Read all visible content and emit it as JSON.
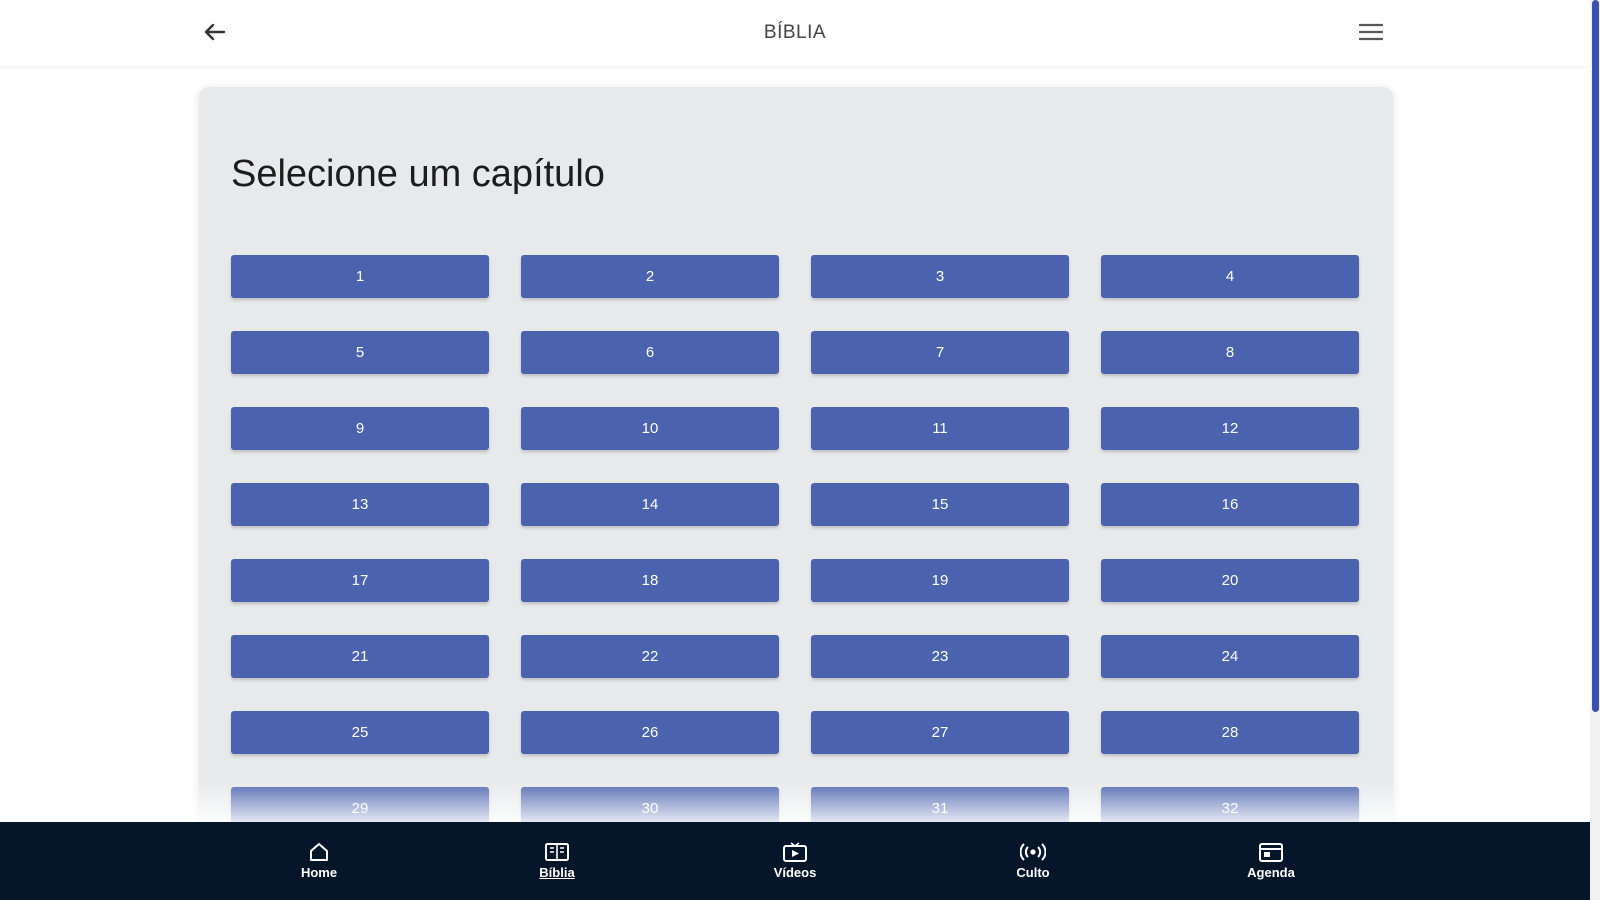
{
  "header": {
    "title": "BÍBLIA",
    "back_icon": "arrow-left-icon",
    "menu_icon": "hamburger-menu-icon"
  },
  "content": {
    "heading": "Selecione um capítulo",
    "chapters": [
      "1",
      "2",
      "3",
      "4",
      "5",
      "6",
      "7",
      "8",
      "9",
      "10",
      "11",
      "12",
      "13",
      "14",
      "15",
      "16",
      "17",
      "18",
      "19",
      "20",
      "21",
      "22",
      "23",
      "24",
      "25",
      "26",
      "27",
      "28",
      "29",
      "30",
      "31",
      "32"
    ]
  },
  "bottom_nav": {
    "items": [
      {
        "label": "Home",
        "icon": "home-icon"
      },
      {
        "label": "Bíblia",
        "icon": "book-icon",
        "active": true
      },
      {
        "label": "Vídeos",
        "icon": "video-icon"
      },
      {
        "label": "Culto",
        "icon": "broadcast-icon"
      },
      {
        "label": "Agenda",
        "icon": "calendar-icon"
      }
    ]
  },
  "colors": {
    "accent": "#4b63ae",
    "nav_background": "#06162a",
    "card_background": "#e8e9eb",
    "scrollbar": "#3c51b4"
  }
}
